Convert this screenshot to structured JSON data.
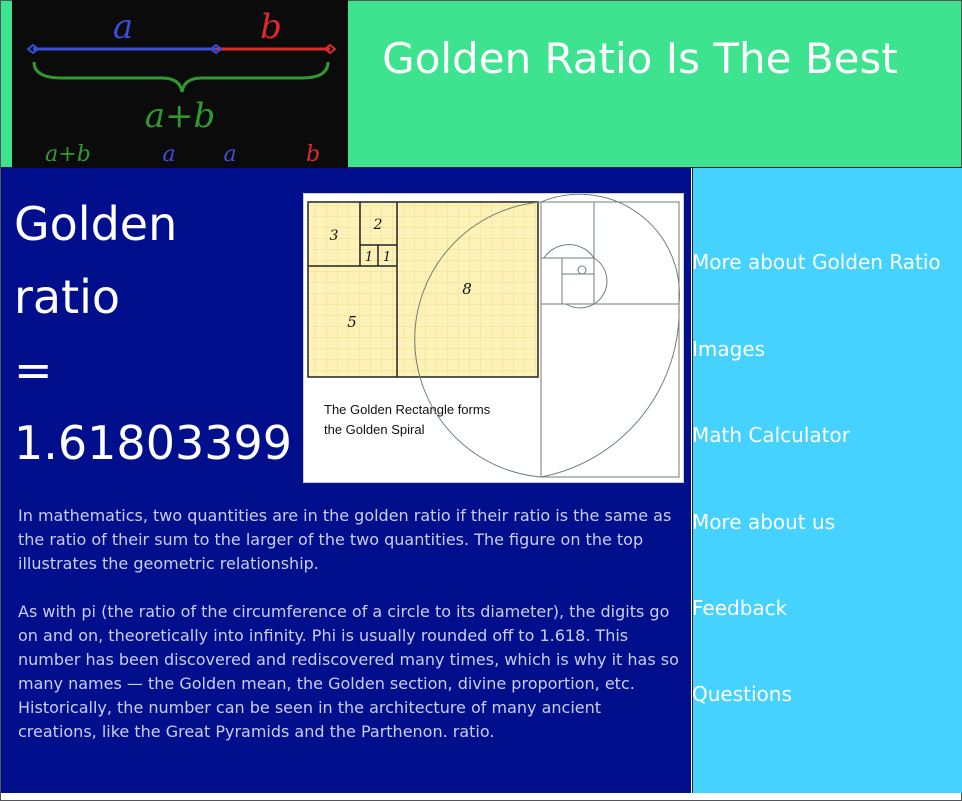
{
  "header": {
    "title": "Golden Ratio Is The Best",
    "background": "#3de38e"
  },
  "logo": {
    "top_labels": {
      "a": "a",
      "b": "b"
    },
    "sum_label": "a+b",
    "ratio_labels": [
      "a+b",
      "a",
      "a",
      "b"
    ],
    "colors": {
      "a": "#3a4fd6",
      "b": "#e02a2a",
      "sum": "#2f9a2f"
    }
  },
  "main": {
    "background": "#020f8c",
    "heading_lines": [
      "Golden",
      "ratio",
      "=",
      "1.61803399"
    ],
    "figure": {
      "square_labels": [
        "3",
        "2",
        "1",
        "1",
        "8",
        "5"
      ],
      "caption_lines": [
        "The Golden Rectangle forms",
        "the Golden Spiral"
      ]
    },
    "paragraphs": [
      "In mathematics, two quantities are in the golden ratio if their ratio is the same as the ratio of their sum to the larger of the two quantities. The figure on the top illustrates the geometric relationship.",
      "As with pi (the ratio of the circumference of a circle to its diameter), the digits go on and on, theoretically into infinity. Phi is usually rounded off to 1.618. This number has been discovered and rediscovered many times, which is why it has so many names — the Golden mean, the Golden section, divine proportion, etc. Historically, the number can be seen in the architecture of many ancient creations, like the Great Pyramids and the Parthenon. ratio."
    ]
  },
  "sidebar": {
    "background": "#46d2ff",
    "items": [
      {
        "label": "More about Golden Ratio"
      },
      {
        "label": "Images"
      },
      {
        "label": "Math Calculator"
      },
      {
        "label": "More about us"
      },
      {
        "label": "Feedback"
      },
      {
        "label": "Questions"
      }
    ]
  }
}
